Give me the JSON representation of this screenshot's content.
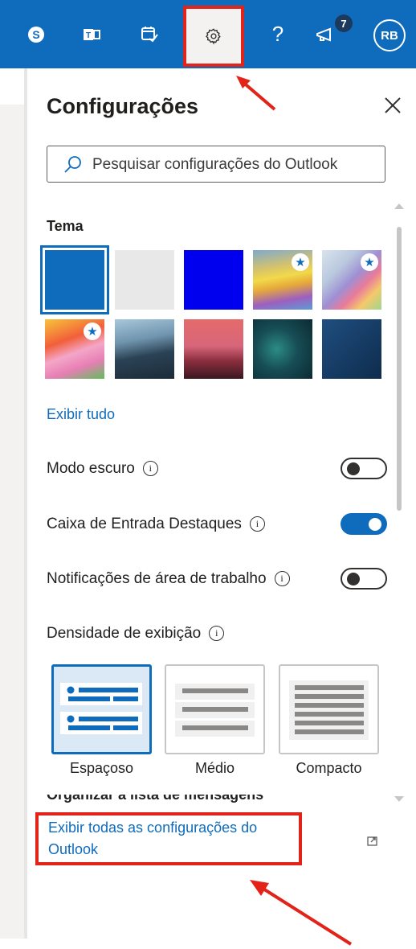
{
  "topbar": {
    "icons": [
      "skype-icon",
      "teams-icon",
      "my-day-icon",
      "settings-icon",
      "help-icon",
      "whats-new-icon"
    ],
    "help_label": "?",
    "notification_count": "7",
    "avatar_initials": "RB"
  },
  "settings": {
    "title": "Configurações",
    "search_placeholder": "Pesquisar configurações do Outlook",
    "theme_label": "Tema",
    "themes": [
      {
        "name": "blue",
        "selected": true,
        "premium": false
      },
      {
        "name": "light-gray",
        "selected": false,
        "premium": false
      },
      {
        "name": "bright-blue",
        "selected": false,
        "premium": false
      },
      {
        "name": "rainbow-waves",
        "selected": false,
        "premium": true
      },
      {
        "name": "ribbons",
        "selected": false,
        "premium": true
      },
      {
        "name": "unicorn",
        "selected": false,
        "premium": true
      },
      {
        "name": "mountain",
        "selected": false,
        "premium": false
      },
      {
        "name": "palm-trees",
        "selected": false,
        "premium": false
      },
      {
        "name": "circuit",
        "selected": false,
        "premium": false
      },
      {
        "name": "blueprint",
        "selected": false,
        "premium": false
      }
    ],
    "show_all": "Exibir tudo",
    "dark_mode_label": "Modo escuro",
    "dark_mode_on": false,
    "focused_inbox_label": "Caixa de Entrada Destaques",
    "focused_inbox_on": true,
    "desktop_notifications_label": "Notificações de área de trabalho",
    "desktop_notifications_on": false,
    "density_label": "Densidade de exibição",
    "density_options": [
      "Espaçoso",
      "Médio",
      "Compacto"
    ],
    "density_selected": "Espaçoso",
    "sort_label_cut": "Organizar a lista de mensagens",
    "view_all_settings": "Exibir todas as configurações do Outlook",
    "info_glyph": "i",
    "star_glyph": "★",
    "accent_color": "#0f6cbd",
    "highlight_color": "#e2231a"
  }
}
